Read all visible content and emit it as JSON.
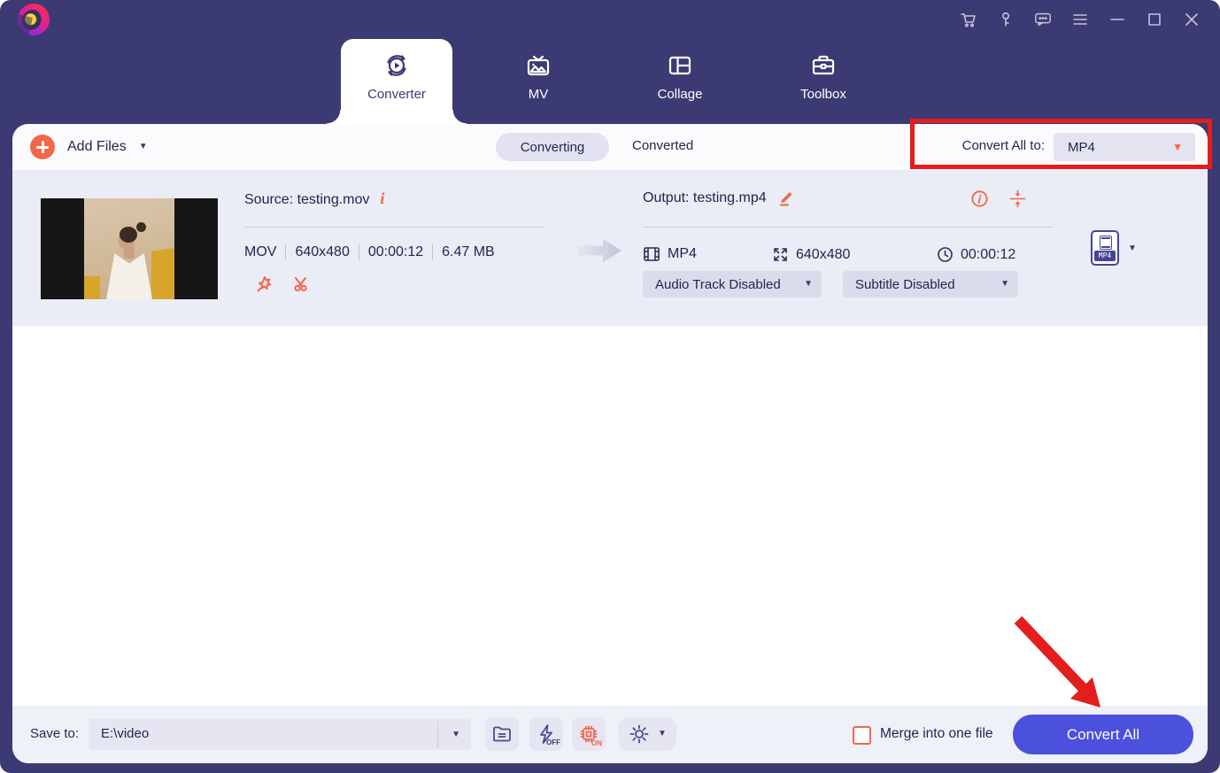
{
  "app": {
    "name": "video-converter-app",
    "colors": {
      "header_purple": "#3b3a72",
      "accent_orange": "#f2664a",
      "convert_button_blue": "#4b50dd",
      "annotation_red": "#e41d1d",
      "row_background": "#eaecf6"
    }
  },
  "icons": {
    "caret_down": "▼",
    "info_i": "i"
  },
  "window_controls": [
    {
      "name": "cart"
    },
    {
      "name": "key"
    },
    {
      "name": "feedback"
    },
    {
      "name": "menu"
    },
    {
      "name": "minimize"
    },
    {
      "name": "maximize"
    },
    {
      "name": "close"
    }
  ],
  "tabs": [
    {
      "label": "Converter",
      "active": true
    },
    {
      "label": "MV",
      "active": false
    },
    {
      "label": "Collage",
      "active": false
    },
    {
      "label": "Toolbox",
      "active": false
    }
  ],
  "toolbar": {
    "add_files_label": "Add Files",
    "filter_tabs": [
      {
        "label": "Converting",
        "active": true
      },
      {
        "label": "Converted",
        "active": false
      }
    ],
    "convert_all_to_label": "Convert All to:",
    "convert_all_to_value": "MP4"
  },
  "file_row": {
    "source_label": "Source: testing.mov",
    "meta": [
      "MOV",
      "640x480",
      "00:00:12",
      "6.47 MB"
    ],
    "output_label": "Output: testing.mp4",
    "output_format": "MP4",
    "output_resolution": "640x480",
    "output_duration": "00:00:12",
    "audio_dropdown": "Audio Track Disabled",
    "subtitle_dropdown": "Subtitle Disabled",
    "format_badge": "MP4"
  },
  "bottom_bar": {
    "save_to_label": "Save to:",
    "save_path": "E:\\video",
    "hw_off_label": "OFF",
    "hw_on_label": "ON",
    "merge_label": "Merge into one file",
    "convert_button_label": "Convert All"
  }
}
